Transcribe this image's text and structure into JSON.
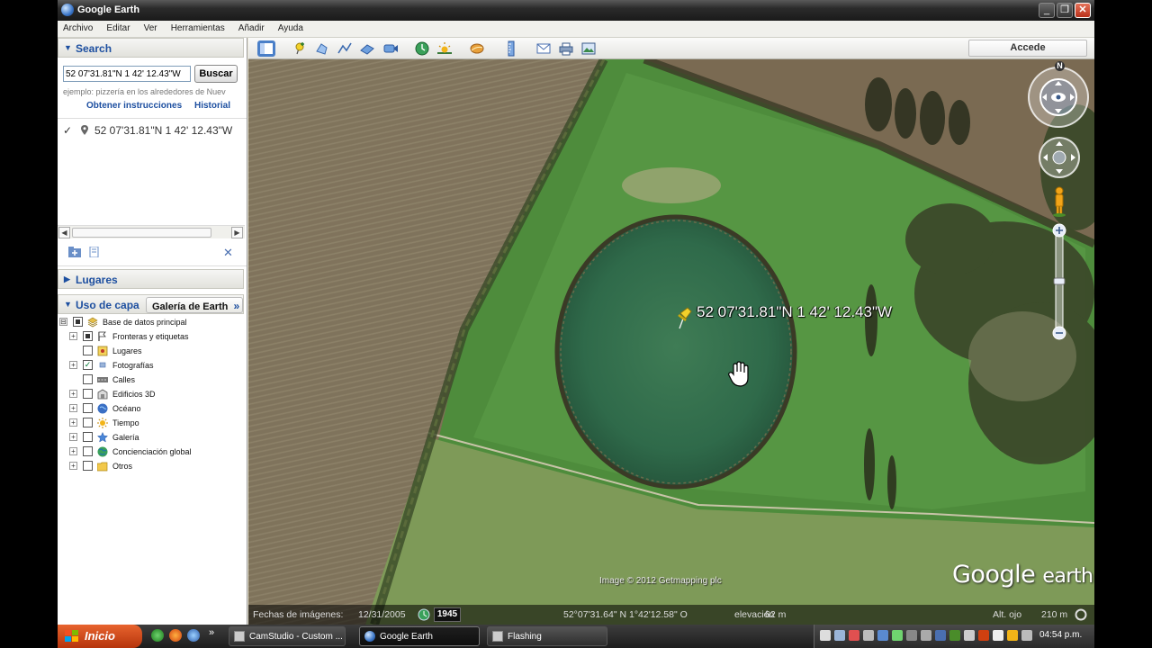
{
  "window": {
    "title": "Google Earth",
    "minimize": "_",
    "restore": "❐",
    "close": "✕"
  },
  "menu": [
    "Archivo",
    "Editar",
    "Ver",
    "Herramientas",
    "Añadir",
    "Ayuda"
  ],
  "search": {
    "header": "Search",
    "input_value": "52 07'31.81\"N 1 42' 12.43\"W",
    "button": "Buscar",
    "example": "ejemplo: pizzería en los alrededores de Nuev",
    "directions_link": "Obtener instrucciones",
    "history_link": "Historial",
    "result": "52 07'31.81\"N 1 42' 12.43\"W",
    "result_check": "✓"
  },
  "places": {
    "header": "Lugares",
    "close": "✕"
  },
  "layers": {
    "header": "Uso de capa",
    "gallery_button": "Galería de Earth",
    "gallery_arrow": "»",
    "items": [
      {
        "label": "Base de datos principal",
        "checked": "partial",
        "expand": "⊟"
      },
      {
        "label": "Fronteras y etiquetas",
        "checked": "partial",
        "expand": "+"
      },
      {
        "label": "Lugares",
        "checked": "none",
        "expand": ""
      },
      {
        "label": "Fotografías",
        "checked": "check",
        "expand": "+"
      },
      {
        "label": "Calles",
        "checked": "none",
        "expand": ""
      },
      {
        "label": "Edificios 3D",
        "checked": "none",
        "expand": "+"
      },
      {
        "label": "Océano",
        "checked": "none",
        "expand": "+"
      },
      {
        "label": "Tiempo",
        "checked": "none",
        "expand": "+"
      },
      {
        "label": "Galería",
        "checked": "none",
        "expand": "+"
      },
      {
        "label": "Concienciación global",
        "checked": "none",
        "expand": "+"
      },
      {
        "label": "Otros",
        "checked": "none",
        "expand": "+"
      }
    ]
  },
  "toolbar": {
    "sign_in": "Accede"
  },
  "map": {
    "placemark_label": "52 07'31.81\"N 1 42' 12.43\"W",
    "copyright": "Image © 2012 Getmapping plc",
    "brand_google": "Google",
    "brand_earth": "earth",
    "compass_north": "N"
  },
  "status": {
    "imagery_date_label": "Fechas de imágenes:",
    "imagery_date": "12/31/2005",
    "year": "1945",
    "coordinates": "52°07'31.64\" N   1°42'12.58\" O",
    "elevation_label": "elevación",
    "elevation": "62 m",
    "eye_alt_label": "Alt. ojo",
    "eye_alt": "210 m"
  },
  "taskbar": {
    "start": "Inicio",
    "expand": "»",
    "tasks": [
      {
        "label": "CamStudio - Custom ...",
        "active": false
      },
      {
        "label": "Google Earth",
        "active": true
      },
      {
        "label": "Flashing",
        "active": false
      }
    ],
    "clock": "04:54 p.m."
  },
  "colors": {
    "accent": "#1d4fa0",
    "start_button": "#d2501e",
    "grass": "#4e8c3c",
    "pond": "#2f6a4a"
  },
  "icons": {
    "app": "google-earth-icon",
    "placemark": "yellow-pushpin-icon",
    "cursor": "hand-cursor-icon",
    "pegman": "street-view-pegman-icon"
  }
}
